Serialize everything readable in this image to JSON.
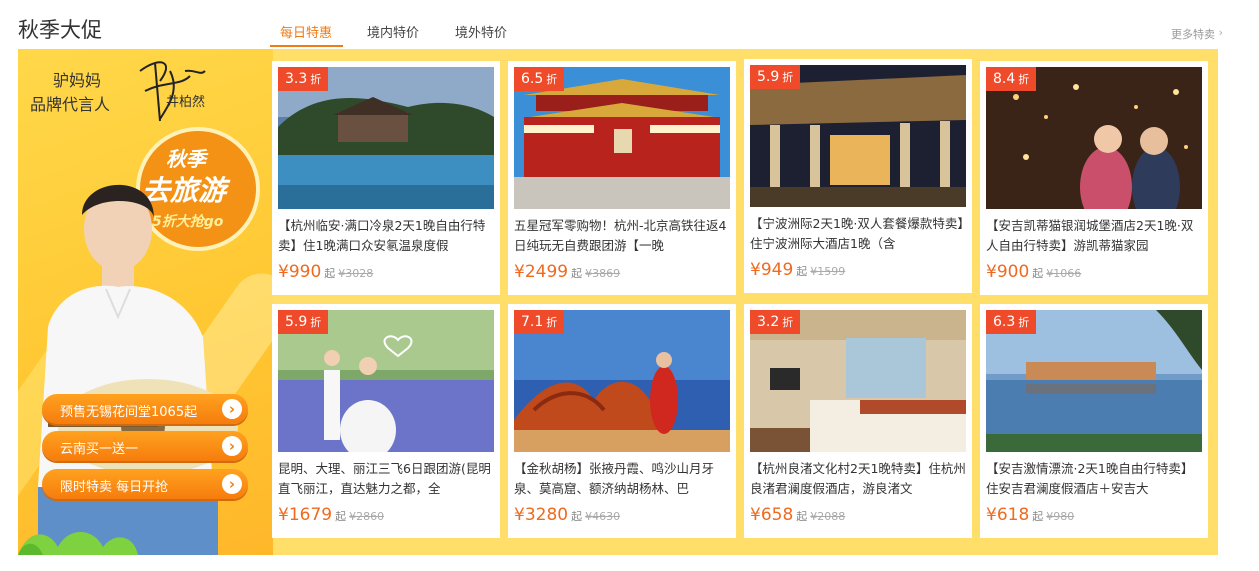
{
  "section": {
    "title": "秋季大促",
    "tabs": [
      "每日特惠",
      "境内特价",
      "境外特价"
    ],
    "more": "更多特卖"
  },
  "banner": {
    "spokes_line1": "驴妈妈",
    "spokes_line2": "品牌代言人",
    "spokes_name": "井柏然",
    "badge_line1": "秋季",
    "badge_line2": "去旅游",
    "badge_line3": "5折大抢go",
    "cta_buttons": [
      "预售无锡花间堂1065起",
      "云南买一送一",
      "限时特卖 每日开抢"
    ]
  },
  "deals": [
    {
      "discount": "3.3",
      "unit": "折",
      "title": "【杭州临安·满口冷泉2天1晚自由行特卖】住1晚满口众安氡温泉度假",
      "price": "¥990",
      "qi": "起",
      "orig": "¥3028",
      "image": "resort-pool-photo"
    },
    {
      "discount": "6.5",
      "unit": "折",
      "title": "五星冠军零购物！杭州-北京高铁往返4日纯玩无自费跟团游【一晚",
      "price": "¥2499",
      "qi": "起",
      "orig": "¥3869",
      "image": "tiananmen-photo"
    },
    {
      "discount": "5.9",
      "unit": "折",
      "title": "【宁波洲际2天1晚·双人套餐爆款特卖】住宁波洲际大酒店1晚（含",
      "price": "¥949",
      "qi": "起",
      "orig": "¥1599",
      "image": "hotel-night-photo"
    },
    {
      "discount": "8.4",
      "unit": "折",
      "title": "【安吉凯蒂猫银润城堡酒店2天1晚·双人自由行特卖】游凯蒂猫家园",
      "price": "¥900",
      "qi": "起",
      "orig": "¥1066",
      "image": "fairy-lights-photo"
    },
    {
      "discount": "5.9",
      "unit": "折",
      "title": "昆明、大理、丽江三飞6日跟团游(昆明直飞丽江，直达魅力之都，全",
      "price": "¥1679",
      "qi": "起",
      "orig": "¥2860",
      "image": "wedding-field-photo"
    },
    {
      "discount": "7.1",
      "unit": "折",
      "title": "【金秋胡杨】张掖丹霞、鸣沙山月牙泉、莫高窟、额济纳胡杨林、巴",
      "price": "¥3280",
      "qi": "起",
      "orig": "¥4630",
      "image": "desert-dance-photo"
    },
    {
      "discount": "3.2",
      "unit": "折",
      "title": "【杭州良渚文化村2天1晚特卖】住杭州良渚君澜度假酒店，游良渚文",
      "price": "¥658",
      "qi": "起",
      "orig": "¥2088",
      "image": "hotel-room-photo"
    },
    {
      "discount": "6.3",
      "unit": "折",
      "title": "【安吉激情漂流·2天1晚自由行特卖】住安吉君澜度假酒店＋安吉大",
      "price": "¥618",
      "qi": "起",
      "orig": "¥980",
      "image": "lake-resort-photo"
    }
  ],
  "colors": {
    "accent": "#f07a14",
    "promo_bg": "#ffde6a",
    "discount_tag": "#ef4a29",
    "price": "#ef6a1f"
  }
}
